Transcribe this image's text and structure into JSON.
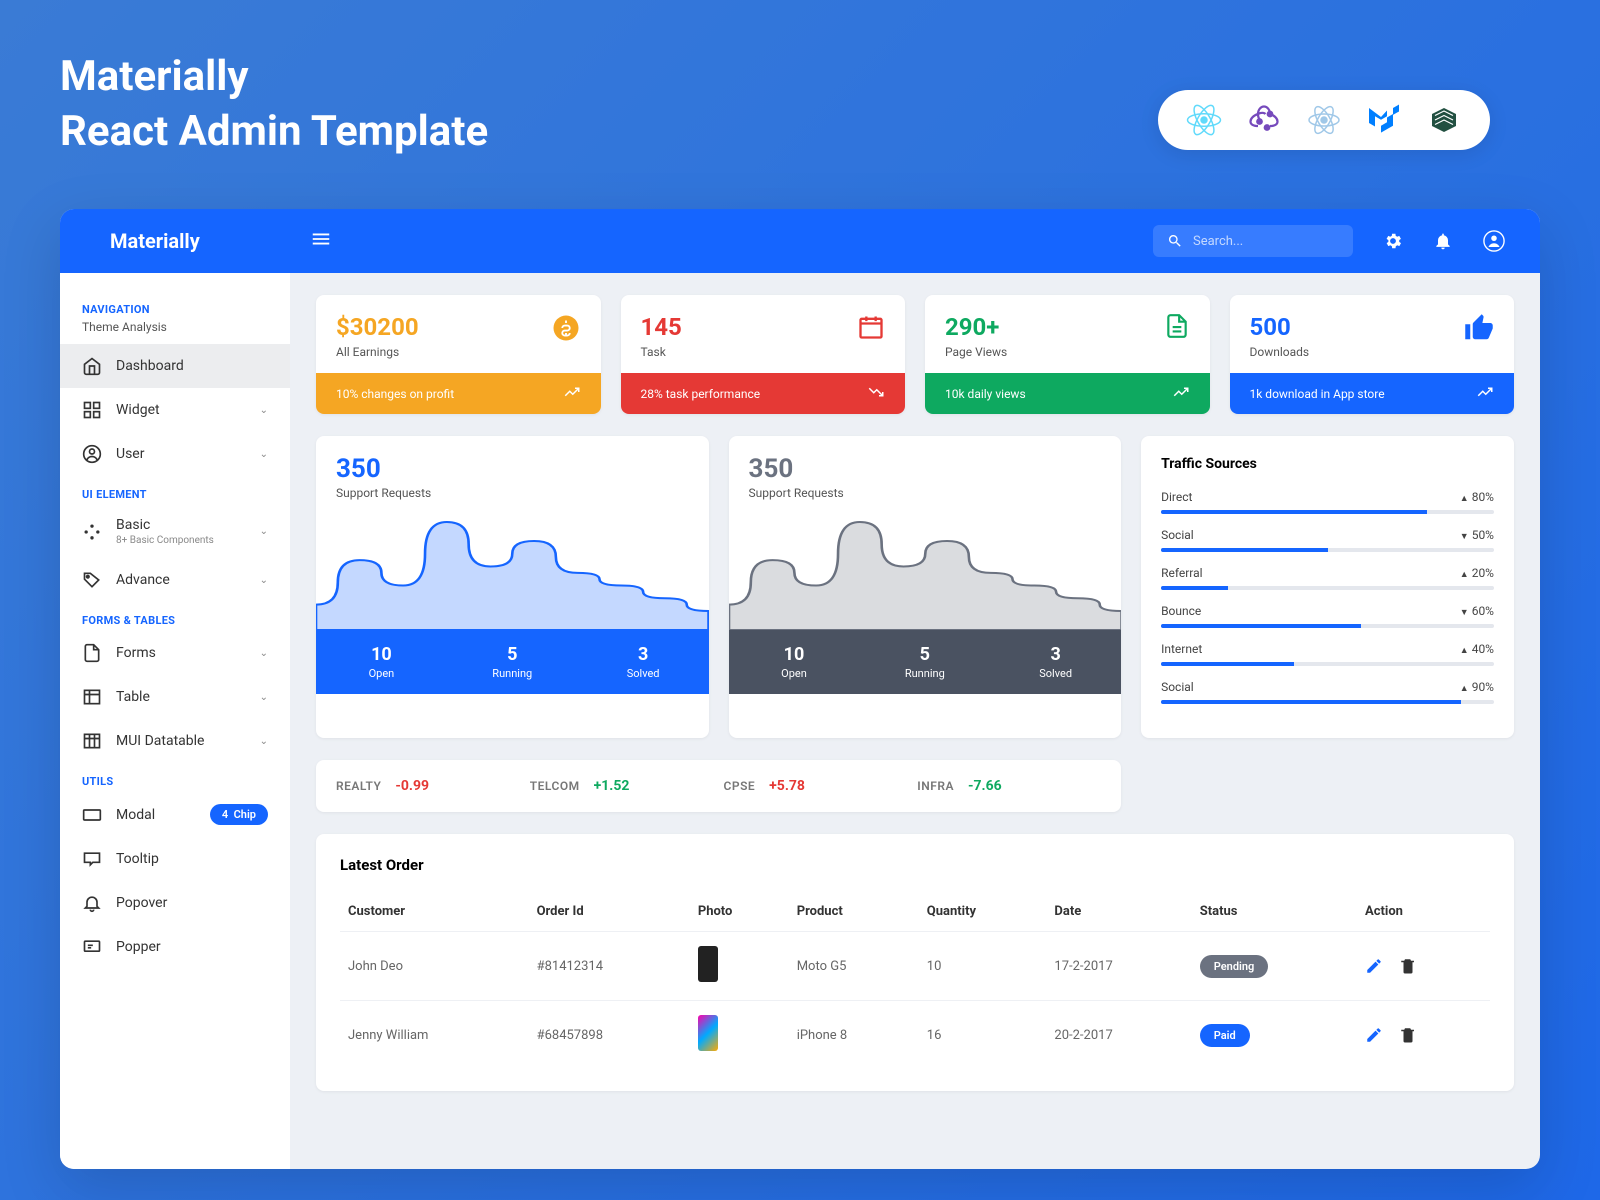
{
  "hero": {
    "line1": "Materially",
    "line2": "React Admin Template"
  },
  "brand": "Materially",
  "search": {
    "placeholder": "Search..."
  },
  "sidebar": {
    "sec1": {
      "header": "NAVIGATION",
      "sub": "Theme Analysis"
    },
    "items1": [
      {
        "label": "Dashboard"
      },
      {
        "label": "Widget"
      },
      {
        "label": "User"
      }
    ],
    "sec2": {
      "header": "UI ELEMENT"
    },
    "items2": [
      {
        "label": "Basic",
        "sub": "8+ Basic Components"
      },
      {
        "label": "Advance"
      }
    ],
    "sec3": {
      "header": "FORMS & TABLES"
    },
    "items3": [
      {
        "label": "Forms"
      },
      {
        "label": "Table"
      },
      {
        "label": "MUI Datatable"
      }
    ],
    "sec4": {
      "header": "UTILS"
    },
    "items4": [
      {
        "label": "Modal",
        "chip_num": "4",
        "chip_txt": "Chip"
      },
      {
        "label": "Tooltip"
      },
      {
        "label": "Popover"
      },
      {
        "label": "Popper"
      }
    ]
  },
  "stats": [
    {
      "value": "$30200",
      "label": "All Earnings",
      "footer": "10% changes on profit",
      "val_color": "#f5a623",
      "foot_bg": "#f5a623"
    },
    {
      "value": "145",
      "label": "Task",
      "footer": "28% task performance",
      "val_color": "#e53935",
      "foot_bg": "#e53935"
    },
    {
      "value": "290+",
      "label": "Page Views",
      "footer": "10k daily views",
      "val_color": "#0ea960",
      "foot_bg": "#0ea960"
    },
    {
      "value": "500",
      "label": "Downloads",
      "footer": "1k download in App store",
      "val_color": "#1565ff",
      "foot_bg": "#1565ff"
    }
  ],
  "support": [
    {
      "value": "350",
      "label": "Support Requests",
      "color": "#1565ff",
      "foot_bg": "#1565ff",
      "open": "10",
      "running": "5",
      "solved": "3",
      "open_l": "Open",
      "run_l": "Running",
      "sol_l": "Solved"
    },
    {
      "value": "350",
      "label": "Support Requests",
      "color": "#6b7280",
      "foot_bg": "#4a5261",
      "open": "10",
      "running": "5",
      "solved": "3",
      "open_l": "Open",
      "run_l": "Running",
      "sol_l": "Solved"
    }
  ],
  "traffic": {
    "title": "Traffic Sources",
    "items": [
      {
        "name": "Direct",
        "pct": "80%",
        "dir": "up",
        "fill": 80
      },
      {
        "name": "Social",
        "pct": "50%",
        "dir": "down",
        "fill": 50
      },
      {
        "name": "Referral",
        "pct": "20%",
        "dir": "up",
        "fill": 20
      },
      {
        "name": "Bounce",
        "pct": "60%",
        "dir": "down",
        "fill": 60
      },
      {
        "name": "Internet",
        "pct": "40%",
        "dir": "up",
        "fill": 40
      },
      {
        "name": "Social",
        "pct": "90%",
        "dir": "up",
        "fill": 90
      }
    ]
  },
  "tickers": [
    {
      "name": "REALTY",
      "val": "-0.99",
      "color": "#e53935"
    },
    {
      "name": "TELCOM",
      "val": "+1.52",
      "color": "#0ea960"
    },
    {
      "name": "CPSE",
      "val": "+5.78",
      "color": "#e53935"
    },
    {
      "name": "INFRA",
      "val": "-7.66",
      "color": "#0ea960"
    }
  ],
  "orders": {
    "title": "Latest Order",
    "headers": {
      "customer": "Customer",
      "order": "Order Id",
      "photo": "Photo",
      "product": "Product",
      "qty": "Quantity",
      "date": "Date",
      "status": "Status",
      "action": "Action"
    },
    "rows": [
      {
        "customer": "John Deo",
        "order": "#81412314",
        "product": "Moto G5",
        "qty": "10",
        "date": "17-2-2017",
        "status": "Pending",
        "status_bg": "#6b7280"
      },
      {
        "customer": "Jenny William",
        "order": "#68457898",
        "product": "iPhone 8",
        "qty": "16",
        "date": "20-2-2017",
        "status": "Paid",
        "status_bg": "#1565ff"
      }
    ]
  },
  "chart_data": [
    {
      "type": "area",
      "title": "Support Requests",
      "total": 350,
      "stats": {
        "Open": 10,
        "Running": 5,
        "Solved": 3
      },
      "values": [
        20,
        55,
        35,
        85,
        50,
        70,
        45,
        35,
        25,
        15
      ],
      "color": "#1565ff"
    },
    {
      "type": "area",
      "title": "Support Requests",
      "total": 350,
      "stats": {
        "Open": 10,
        "Running": 5,
        "Solved": 3
      },
      "values": [
        20,
        55,
        35,
        85,
        50,
        70,
        45,
        35,
        25,
        15
      ],
      "color": "#6b7280"
    }
  ]
}
